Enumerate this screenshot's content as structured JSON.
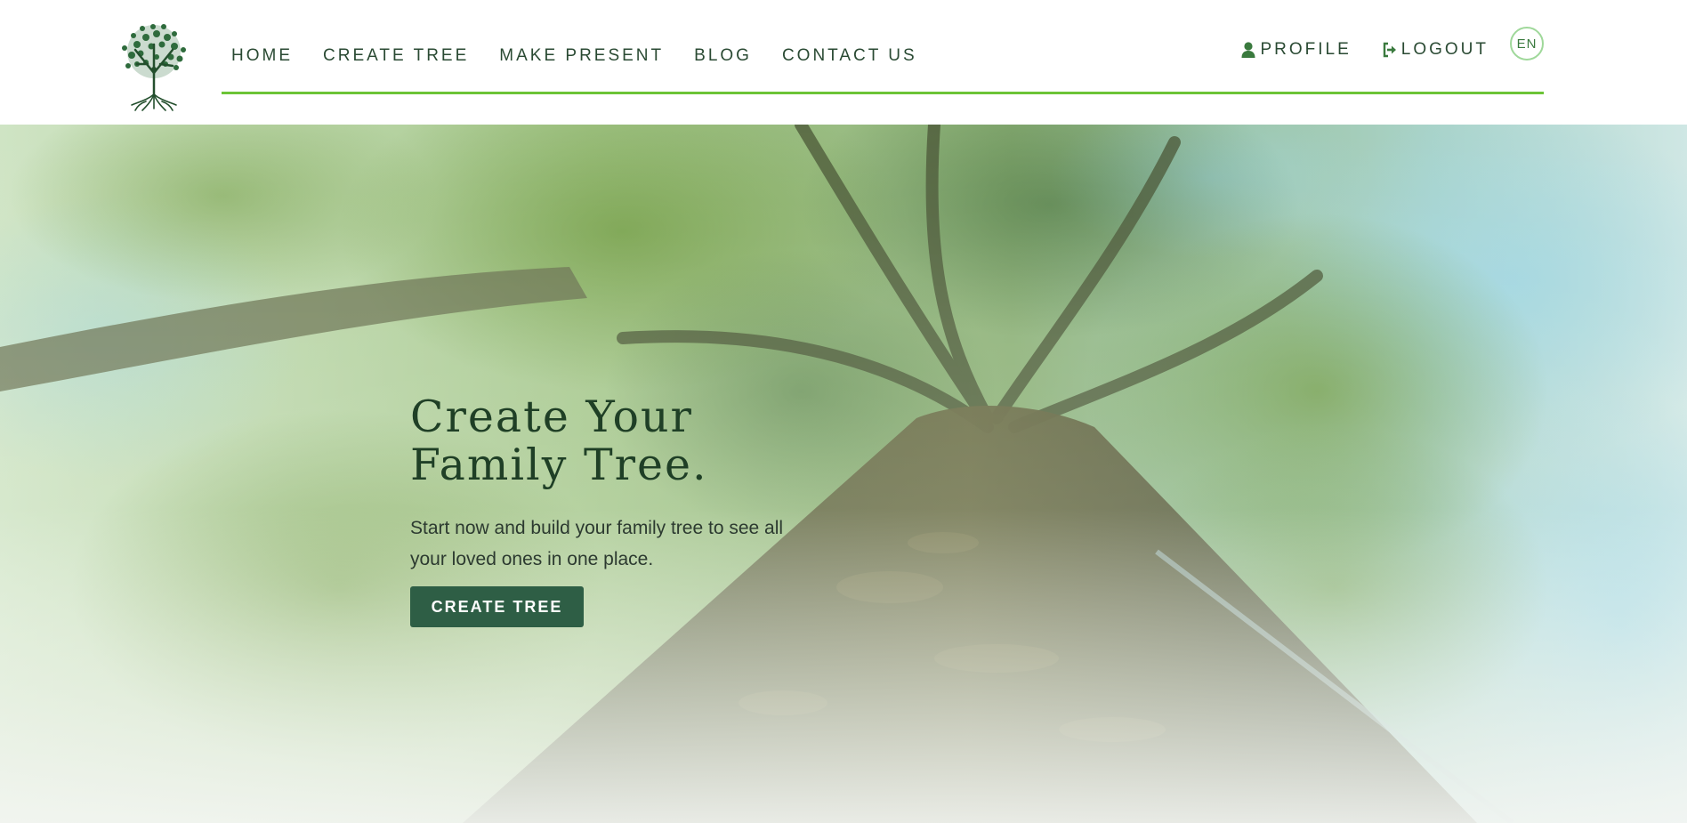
{
  "header": {
    "logo_alt": "Family tree logo",
    "nav": {
      "home": "HOME",
      "create_tree": "CREATE TREE",
      "make_present": "MAKE PRESENT",
      "blog": "BLOG",
      "contact_us": "CONTACT US"
    },
    "account": {
      "profile": "PROFILE",
      "profile_icon": "user-icon",
      "logout": "LOGOUT",
      "logout_icon": "sign-out-icon",
      "language": "EN"
    },
    "accent_color": "#6cc436"
  },
  "hero": {
    "title": "Create Your\nFamily Tree.",
    "subtitle": "Start now and build your family tree to see all your loved ones in one place.",
    "cta_label": "CREATE TREE",
    "cta_color": "#2e5e45"
  }
}
